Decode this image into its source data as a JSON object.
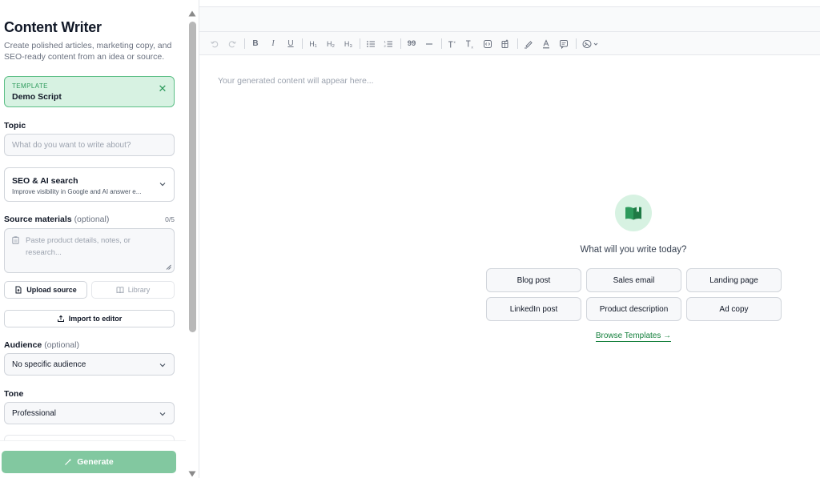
{
  "sidebar": {
    "title": "Content Writer",
    "subtitle": "Create polished articles, marketing copy, and SEO-ready content from an idea or source.",
    "template": {
      "label": "TEMPLATE",
      "name": "Demo Script"
    },
    "topic": {
      "label": "Topic",
      "placeholder": "What do you want to write about?"
    },
    "seo": {
      "title": "SEO & AI search",
      "subtitle": "Improve visibility in Google and AI answer e..."
    },
    "source": {
      "label": "Source materials",
      "optional": "(optional)",
      "counter": "0/5",
      "placeholder": "Paste product details, notes, or research..."
    },
    "upload_label": "Upload source",
    "library_label": "Library",
    "import_label": "Import to editor",
    "audience": {
      "label": "Audience",
      "optional": "(optional)",
      "value": "No specific audience"
    },
    "tone": {
      "label": "Tone",
      "value": "Professional"
    },
    "generate_label": "Generate"
  },
  "editor": {
    "placeholder": "Your generated content will appear here...",
    "empty_question": "What will you write today?",
    "suggestions": [
      "Blog post",
      "Sales email",
      "Landing page",
      "LinkedIn post",
      "Product description",
      "Ad copy"
    ],
    "browse_label": "Browse Templates →"
  },
  "toolbar": {
    "h1": "H₁",
    "h2": "H₂",
    "h3": "H₃",
    "quote": "99"
  },
  "colors": {
    "accent": "#2d9a5c",
    "accent_light": "#d7f2e2",
    "generate_disabled": "#82c8a0"
  }
}
